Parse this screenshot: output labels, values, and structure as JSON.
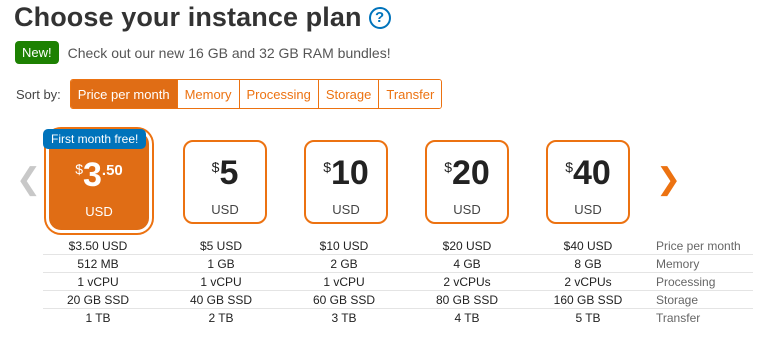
{
  "header": {
    "title": "Choose your instance plan",
    "help_icon": "?"
  },
  "announcement": {
    "badge": "New!",
    "text": "Check out our new 16 GB and 32 GB RAM bundles!"
  },
  "sort": {
    "label": "Sort by:",
    "options": [
      "Price per month",
      "Memory",
      "Processing",
      "Storage",
      "Transfer"
    ],
    "active": "Price per month"
  },
  "promo_badge": "First month free!",
  "plans": [
    {
      "currency": "$",
      "amount": "3",
      "decimal": ".50",
      "unit": "USD",
      "price": "$3.50 USD",
      "memory": "512 MB",
      "processing": "1 vCPU",
      "storage": "20 GB SSD",
      "transfer": "1 TB",
      "selected": true
    },
    {
      "currency": "$",
      "amount": "5",
      "decimal": "",
      "unit": "USD",
      "price": "$5 USD",
      "memory": "1 GB",
      "processing": "1 vCPU",
      "storage": "40 GB SSD",
      "transfer": "2 TB",
      "selected": false
    },
    {
      "currency": "$",
      "amount": "10",
      "decimal": "",
      "unit": "USD",
      "price": "$10 USD",
      "memory": "2 GB",
      "processing": "1 vCPU",
      "storage": "60 GB SSD",
      "transfer": "3 TB",
      "selected": false
    },
    {
      "currency": "$",
      "amount": "20",
      "decimal": "",
      "unit": "USD",
      "price": "$20 USD",
      "memory": "4 GB",
      "processing": "2 vCPUs",
      "storage": "80 GB SSD",
      "transfer": "4 TB",
      "selected": false
    },
    {
      "currency": "$",
      "amount": "40",
      "decimal": "",
      "unit": "USD",
      "price": "$40 USD",
      "memory": "8 GB",
      "processing": "2 vCPUs",
      "storage": "160 GB SSD",
      "transfer": "5 TB",
      "selected": false
    }
  ],
  "row_labels": {
    "price": "Price per month",
    "memory": "Memory",
    "processing": "Processing",
    "storage": "Storage",
    "transfer": "Transfer"
  },
  "nav": {
    "prev_icon": "chevron-left-icon",
    "next_icon": "chevron-right-icon"
  },
  "colors": {
    "accent": "#ec7211",
    "selected_fill": "#e06d15",
    "new_badge": "#1d8102",
    "promo": "#0073bb",
    "disabled": "#c8c8c8"
  }
}
